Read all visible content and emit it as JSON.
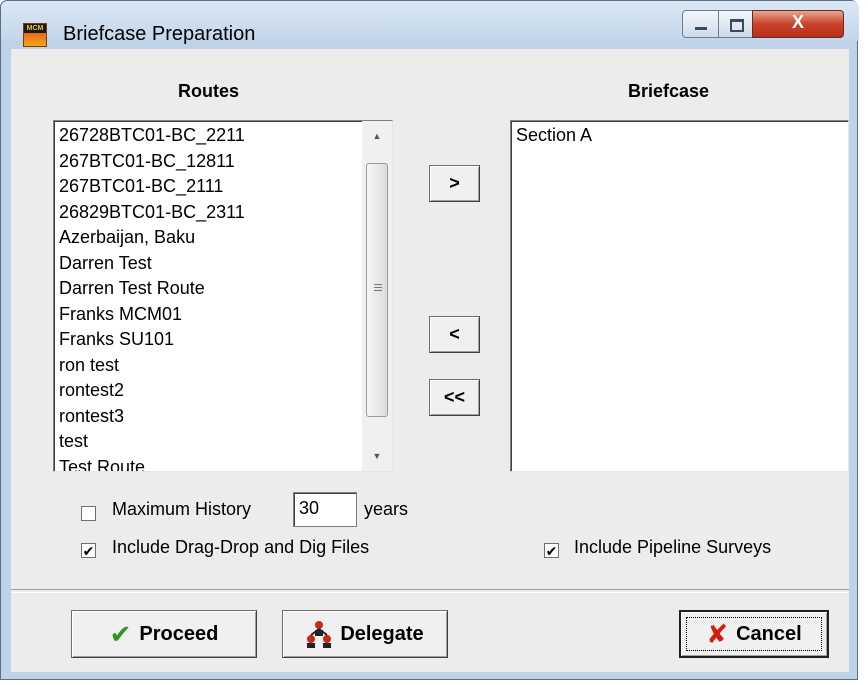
{
  "window": {
    "title": "Briefcase Preparation",
    "icon": "mcm-app-icon",
    "icon_text": "MCM"
  },
  "routes": {
    "heading": "Routes",
    "items": [
      "26728BTC01-BC_2211",
      "267BTC01-BC_12811",
      "267BTC01-BC_2111",
      "26829BTC01-BC_2311",
      "Azerbaijan, Baku",
      "Darren Test",
      "Darren Test Route",
      "Franks MCM01",
      "Franks SU101",
      "ron test",
      "rontest2",
      "rontest3",
      "test",
      "Test Route"
    ]
  },
  "briefcase": {
    "heading": "Briefcase",
    "items": [
      "Section A"
    ]
  },
  "transfer_buttons": {
    "add": ">",
    "remove": "<",
    "remove_all": "<<"
  },
  "options": {
    "max_history_label": "Maximum History",
    "max_history_checked": false,
    "max_history_value": "30",
    "years_label": "years",
    "include_dragdrop_label": "Include Drag-Drop and Dig Files",
    "include_dragdrop_checked": true,
    "include_pipeline_label": "Include Pipeline Surveys",
    "include_pipeline_checked": true
  },
  "actions": {
    "proceed": "Proceed",
    "delegate": "Delegate",
    "cancel": "Cancel"
  },
  "colors": {
    "check_green": "#2a9a1a",
    "cancel_red": "#d21e0f",
    "delegate_red": "#c62814"
  }
}
